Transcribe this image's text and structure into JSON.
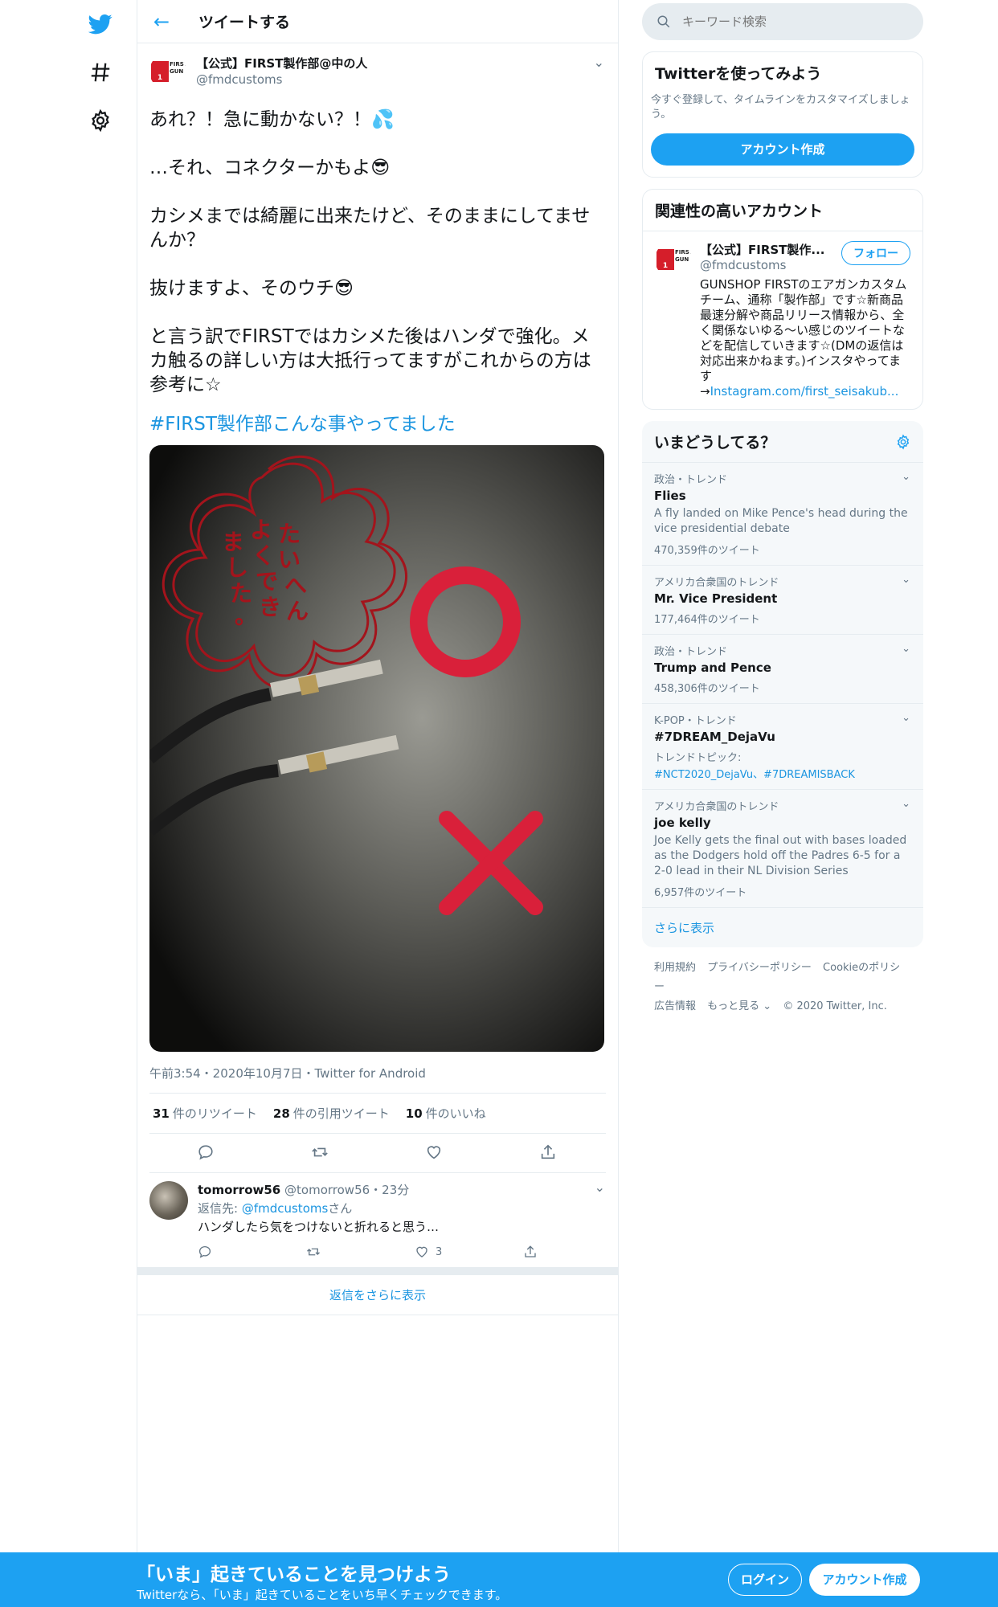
{
  "nav": {
    "twitter": "twitter-logo",
    "explore": "hashtag-icon",
    "settings": "gear-icon"
  },
  "header": {
    "title": "ツイートする"
  },
  "tweet": {
    "author_name": "【公式】FIRST製作部@中の人",
    "author_handle": "@fmdcustoms",
    "logo_text": "FIRST GUN",
    "text": "あれ？！急に動かない？！💦\n\n…それ、コネクターかもよ😎\n\nカシメまでは綺麗に出来たけど、そのままにしてませんか？\n\n抜けますよ、そのウチ😎\n\nと言う訳でFIRSTではカシメた後はハンダで強化。メカ触るの詳しい方は大抵行ってますがこれからの方は参考に☆",
    "hashtag": "#FIRST製作部こんな事やってました",
    "media_text": "たいへんよくできました。",
    "meta": "午前3:54・2020年10月7日・Twitter for Android",
    "stats": [
      {
        "count": "31",
        "label": "件のリツイート"
      },
      {
        "count": "28",
        "label": "件の引用ツイート"
      },
      {
        "count": "10",
        "label": "件のいいね"
      }
    ]
  },
  "reply": {
    "name": "tomorrow56",
    "handle_time": "@tomorrow56・23分",
    "reply_to_prefix": "返信先: ",
    "reply_to_user": "@fmdcustoms",
    "reply_to_suffix": "さん",
    "text": "ハンダしたら気をつけないと折れると思う…",
    "likes": "3"
  },
  "show_more_replies": "返信をさらに表示",
  "search": {
    "placeholder": "キーワード検索"
  },
  "signup_card": {
    "title": "Twitterを使ってみよう",
    "desc": "今すぐ登録して、タイムラインをカスタマイズしましょう。",
    "button": "アカウント作成"
  },
  "related": {
    "title": "関連性の高いアカウント",
    "name": "【公式】FIRST製作...",
    "handle": "@fmdcustoms",
    "follow": "フォロー",
    "bio": "GUNSHOP FIRSTのエアガンカスタムチーム、通称「製作部」です☆新商品最速分解や商品リリース情報から、全く関係ないゆる〜い感じのツイートなどを配信していきます☆(DMの返信は対応出来かねます。)インスタやってます→",
    "bio_link": "Instagram.com/first_seisakub..."
  },
  "trends": {
    "title": "いまどうしてる？",
    "items": [
      {
        "context": "政治・トレンド",
        "name": "Flies",
        "desc": "A fly landed on Mike Pence's head during the vice presidential debate",
        "count": "470,359件のツイート"
      },
      {
        "context": "アメリカ合衆国のトレンド",
        "name": "Mr. Vice President",
        "count": "177,464件のツイート"
      },
      {
        "context": "政治・トレンド",
        "name": "Trump and Pence",
        "count": "458,306件のツイート"
      },
      {
        "context": "K-POP・トレンド",
        "name": "#7DREAM_DejaVu",
        "topics_label": "トレンドトピック:",
        "topics": "#NCT2020_DejaVu、#7DREAMISBACK"
      },
      {
        "context": "アメリカ合衆国のトレンド",
        "name": "joe kelly",
        "desc": "Joe Kelly gets the final out with bases loaded as the Dodgers hold off the Padres 6-5 for a 2-0 lead in their NL Division Series",
        "count": "6,957件のツイート"
      }
    ],
    "more": "さらに表示"
  },
  "footer": {
    "terms": "利用規約",
    "privacy": "プライバシーポリシー",
    "cookie": "Cookieのポリシー",
    "ads": "広告情報",
    "more": "もっと見る ⌄",
    "copyright": "© 2020 Twitter, Inc."
  },
  "bottom_bar": {
    "title": "「いま」起きていることを見つけよう",
    "subtitle": "Twitterなら、「いま」起きていることをいち早くチェックできます。",
    "login": "ログイン",
    "signup": "アカウント作成"
  },
  "colors": {
    "accent": "#1da1f2",
    "link": "#1b95e0",
    "brand_red": "#d51e2a"
  }
}
